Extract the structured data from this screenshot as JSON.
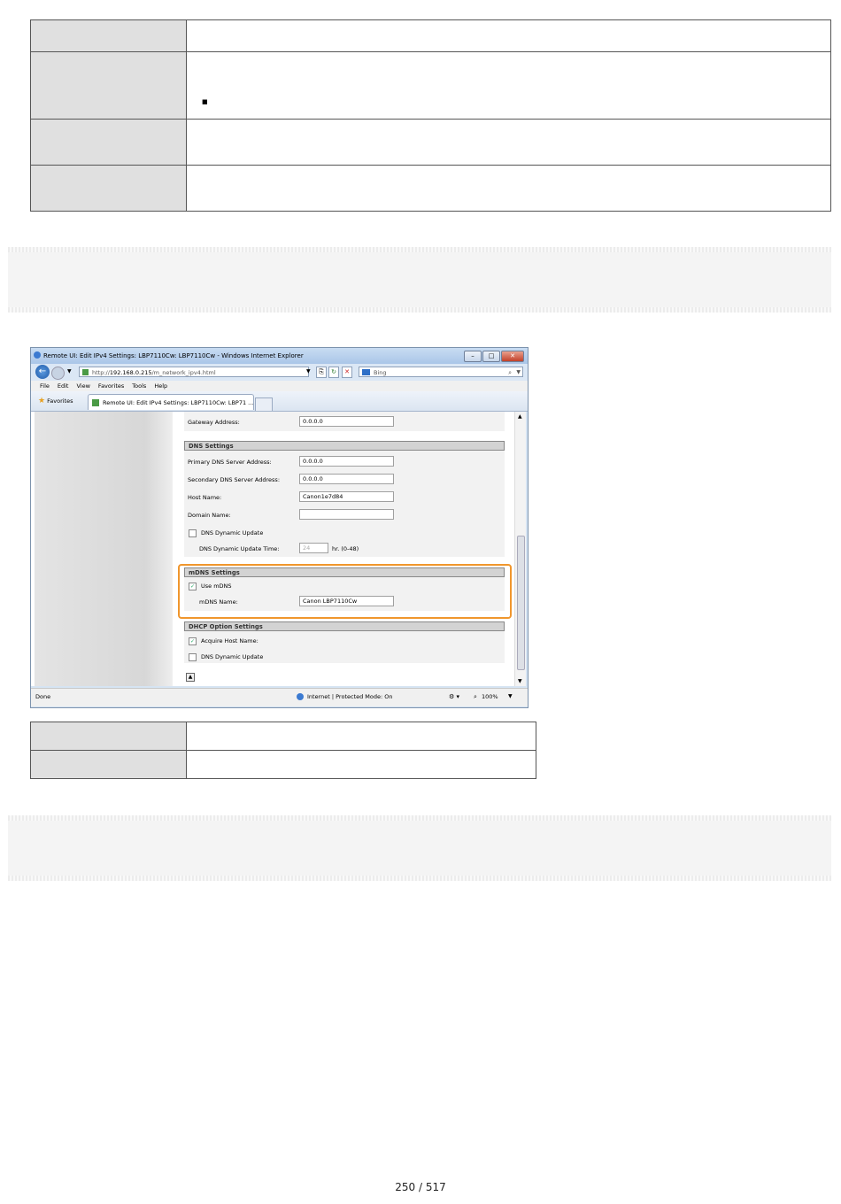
{
  "browser": {
    "window_title": "Remote UI: Edit IPv4 Settings: LBP7110Cw: LBP7110Cw - Windows Internet Explorer",
    "url_prefix": "http://",
    "url_host": "192.168.0.215",
    "url_path": "/m_network_ipv4.html",
    "search_placeholder": "Bing",
    "menu": [
      "File",
      "Edit",
      "View",
      "Favorites",
      "Tools",
      "Help"
    ],
    "favorites_label": "Favorites",
    "tab_label": "Remote UI: Edit IPv4 Settings: LBP7110Cw: LBP71 ...",
    "status_left": "Done",
    "status_zone": "Internet | Protected Mode: On",
    "zoom": "100%"
  },
  "form": {
    "gateway_label": "Gateway Address:",
    "gateway_value": "0.0.0.0",
    "dns_section": "DNS Settings",
    "primary_dns_label": "Primary DNS Server Address:",
    "primary_dns_value": "0.0.0.0",
    "secondary_dns_label": "Secondary DNS Server Address:",
    "secondary_dns_value": "0.0.0.0",
    "host_name_label": "Host Name:",
    "host_name_value": "Canon1e7d84",
    "domain_name_label": "Domain Name:",
    "domain_name_value": "",
    "dns_dynamic_update_label": "DNS Dynamic Update",
    "dns_dynamic_update_time_label": "DNS Dynamic Update Time:",
    "dns_dynamic_update_time_value": "24",
    "dns_dynamic_update_time_unit": "hr. (0-48)",
    "mdns_section": "mDNS Settings",
    "use_mdns_label": "Use mDNS",
    "use_mdns_checked": "✓",
    "mdns_name_label": "mDNS Name:",
    "mdns_name_value": "Canon LBP7110Cw",
    "dhcp_section": "DHCP Option Settings",
    "acquire_host_label": "Acquire Host Name:",
    "acquire_host_checked": "✓",
    "dhcp_dns_update_label": "DNS Dynamic Update"
  },
  "bullet": "■",
  "page_number": "250 / 517"
}
